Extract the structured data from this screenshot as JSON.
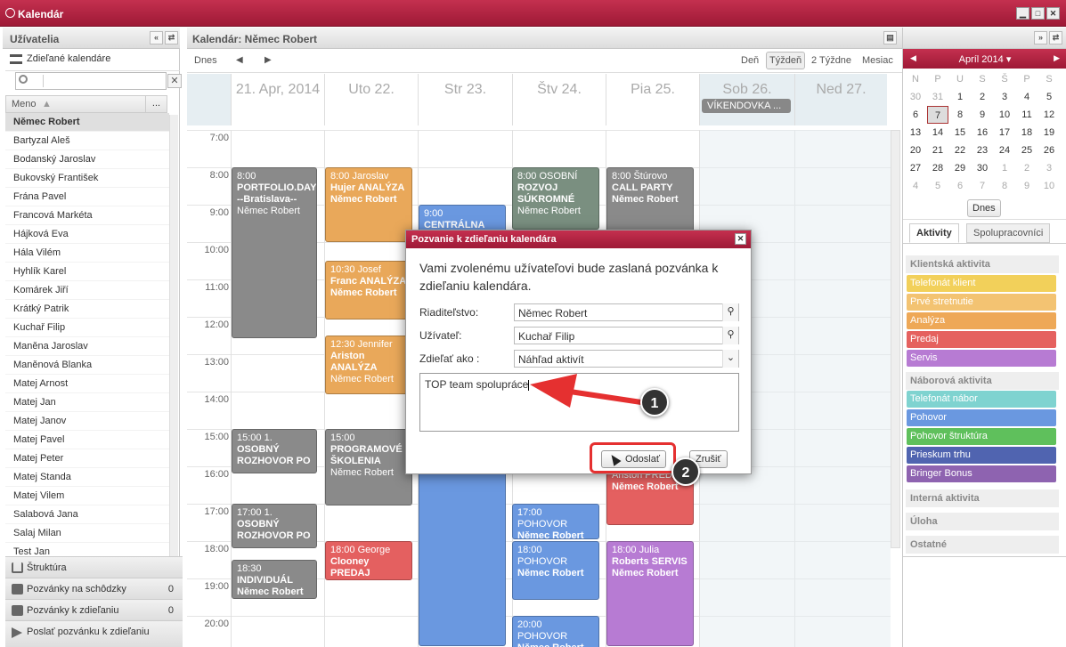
{
  "window": {
    "title": "Kalendár"
  },
  "left": {
    "header": "Užívatelia",
    "shared": "Zdieľané kalendáre",
    "col_name": "Meno",
    "col_more": "...",
    "users": [
      "Němec Robert",
      "Bartyzal Aleš",
      "Bodanský Jaroslav",
      "Bukovský František",
      "Frána Pavel",
      "Francová Markéta",
      "Hájková Eva",
      "Hála Vilém",
      "Hyhlík Karel",
      "Komárek Jiří",
      "Krátký Patrik",
      "Kuchař Filip",
      "Maněna Jaroslav",
      "Maněnová Blanka",
      "Matej Arnost",
      "Matej Jan",
      "Matej Janov",
      "Matej Pavel",
      "Matej Peter",
      "Matej Standa",
      "Matej Vilem",
      "Salabová Jana",
      "Salaj Milan",
      "Test Jan"
    ],
    "structure": "Štruktúra",
    "invites_meeting": "Pozvánky na schôdzky",
    "invites_meeting_count": "0",
    "invites_share": "Pozvánky k zdieľaniu",
    "invites_share_count": "0",
    "send_invite": "Poslať pozvánku k zdieľaniu"
  },
  "center": {
    "header": "Kalendár: Němec Robert",
    "today": "Dnes",
    "views": [
      "Deň",
      "Týždeň",
      "2 Týždne",
      "Mesiac"
    ],
    "days": [
      "21. Apr, 2014",
      "Uto 22.",
      "Str 23.",
      "Štv 24.",
      "Pia 25.",
      "Sob 26.",
      "Ned 27."
    ],
    "weekend_event": "VÍKENDOVKA ...",
    "hours": [
      "7:00",
      "8:00",
      "9:00",
      "10:00",
      "11:00",
      "12:00",
      "13:00",
      "14:00",
      "15:00",
      "16:00",
      "17:00",
      "18:00",
      "19:00",
      "20:00"
    ],
    "events": [
      {
        "l1": "8:00",
        "l2": "PORTFOLIO.DAY",
        "l3": "--Bratislava--",
        "l4": "Němec Robert"
      },
      {
        "l1": "15:00  1.",
        "l2": "OSOBNÝ",
        "l3": "ROZHOVOR PO",
        "l4": ""
      },
      {
        "l1": "17:00  1.",
        "l2": "OSOBNÝ",
        "l3": "ROZHOVOR PO",
        "l4": ""
      },
      {
        "l1": "18:30",
        "l2": "INDIVIDUÁL",
        "l3": "Němec Robert",
        "l4": ""
      },
      {
        "l1": "8:00 Jaroslav",
        "l2": "Hujer ANALÝZA",
        "l3": "Němec Robert",
        "l4": ""
      },
      {
        "l1": "10:30 Josef",
        "l2": "Franc ANALÝZA",
        "l3": "Němec Robert",
        "l4": ""
      },
      {
        "l1": "12:30 Jennifer",
        "l2": "Ariston",
        "l3": "ANALÝZA",
        "l4": "Němec Robert"
      },
      {
        "l1": "15:00",
        "l2": "PROGRAMOVÉ",
        "l3": "ŠKOLENIA",
        "l4": "Němec Robert"
      },
      {
        "l1": "18:00 George",
        "l2": "Clooney PREDAJ",
        "l3": "Němec Robert",
        "l4": ""
      },
      {
        "l1": "9:00",
        "l2": "CENTRÁLNA",
        "l3": "",
        "l4": ""
      },
      {
        "l1": "8:00 OSOBNÍ",
        "l2": "ROZVOJ",
        "l3": "SÚKROMNÉ",
        "l4": "Němec Robert"
      },
      {
        "l1": "17:00  POHOVOR",
        "l2": "Němec Robert",
        "l3": "",
        "l4": ""
      },
      {
        "l1": "18:00  POHOVOR",
        "l2": "Němec Robert",
        "l3": "",
        "l4": ""
      },
      {
        "l1": "20:00  POHOVOR",
        "l2": "Němec Robert",
        "l3": "",
        "l4": ""
      },
      {
        "l1": "8:00 Štúrovo",
        "l2": "CALL PARTY",
        "l3": "Němec Robert",
        "l4": ""
      },
      {
        "l1": "Ariston PREDAJ",
        "l2": "Němec Robert",
        "l3": "",
        "l4": ""
      },
      {
        "l1": "18:00 Julia",
        "l2": "Roberts SERVIS",
        "l3": "Němec Robert",
        "l4": ""
      }
    ]
  },
  "right": {
    "month": "Apríl 2014",
    "today_btn": "Dnes",
    "weekdays": [
      "N",
      "P",
      "U",
      "S",
      "Š",
      "P",
      "S"
    ],
    "weeks": [
      [
        "30",
        "31",
        "1",
        "2",
        "3",
        "4",
        "5"
      ],
      [
        "6",
        "7",
        "8",
        "9",
        "10",
        "11",
        "12"
      ],
      [
        "13",
        "14",
        "15",
        "16",
        "17",
        "18",
        "19"
      ],
      [
        "20",
        "21",
        "22",
        "23",
        "24",
        "25",
        "26"
      ],
      [
        "27",
        "28",
        "29",
        "30",
        "1",
        "2",
        "3"
      ],
      [
        "4",
        "5",
        "6",
        "7",
        "8",
        "9",
        "10"
      ]
    ],
    "tabs": [
      "Aktivity",
      "Spolupracovníci"
    ],
    "sections": {
      "client": "Klientská aktivita",
      "recruit": "Náborová aktivita",
      "internal": "Interná aktivita",
      "task": "Úloha",
      "other": "Ostatné"
    },
    "client_items": [
      "Telefonát klient",
      "Prvé stretnutie",
      "Analýza",
      "Predaj",
      "Servis"
    ],
    "recruit_items": [
      "Telefonát nábor",
      "Pohovor",
      "Pohovor štruktúra",
      "Prieskum trhu",
      "Bringer Bonus"
    ],
    "colors": {
      "client": [
        "#f2d05a",
        "#f3c372",
        "#eea857",
        "#e5615f",
        "#b77bd3"
      ],
      "recruit": [
        "#7fd3d0",
        "#6a98e0",
        "#5fc05c",
        "#5064b0",
        "#8e63b0"
      ]
    }
  },
  "dialog": {
    "title": "Pozvanie k zdieľaniu kalendára",
    "message": "Vami zvolenému užívateľovi bude zaslaná pozvánka k zdieľaniu kalendára.",
    "director_label": "Riaditeľstvo:",
    "director_value": "Němec Robert",
    "user_label": "Užívateľ:",
    "user_value": "Kuchař Filip",
    "share_label": "Zdieľať ako :",
    "share_value": "Náhľad aktivít",
    "note": "TOP team spolupráce",
    "send": "Odoslať",
    "cancel": "Zrušiť"
  },
  "callouts": [
    "1",
    "2"
  ]
}
